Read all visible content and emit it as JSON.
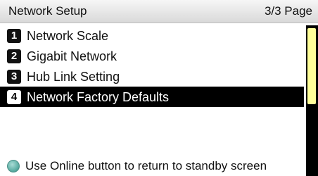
{
  "header": {
    "title": "Network Setup",
    "page": "3/3 Page"
  },
  "menu": {
    "items": [
      {
        "number": "1",
        "label": "Network Scale",
        "selected": false
      },
      {
        "number": "2",
        "label": "Gigabit Network",
        "selected": false
      },
      {
        "number": "3",
        "label": "Hub Link Setting",
        "selected": false
      },
      {
        "number": "4",
        "label": "Network Factory Defaults",
        "selected": true
      }
    ]
  },
  "footer": {
    "indicator_icon": "online-led-icon",
    "hint": "Use Online button to return to standby screen"
  },
  "colors": {
    "selected_bg": "#000000",
    "scroll_thumb": "#ffff99",
    "led": "#5fb0a6"
  }
}
